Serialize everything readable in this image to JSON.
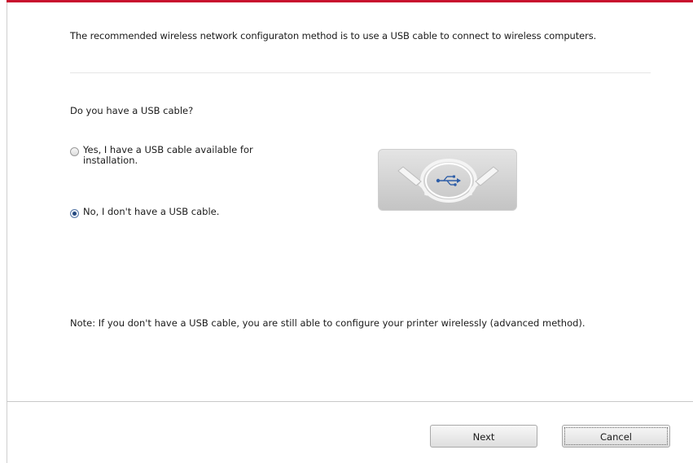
{
  "intro_text": "The recommended wireless network configuraton method is to use a USB cable to connect to wireless computers.",
  "question": "Do you have a USB cable?",
  "options": [
    {
      "label": "Yes, I have a USB cable available for installation.",
      "selected": false
    },
    {
      "label": "No, I don't have a USB cable.",
      "selected": true
    }
  ],
  "image": {
    "icon": "usb-cable-icon"
  },
  "note": "Note:  If you don't have a USB cable, you are still able to configure your printer wirelessly (advanced method).",
  "buttons": {
    "next_label": "Next",
    "cancel_label": "Cancel"
  },
  "colors": {
    "accent_top_bar": "#c8102e",
    "radio_checked": "#23487f"
  }
}
